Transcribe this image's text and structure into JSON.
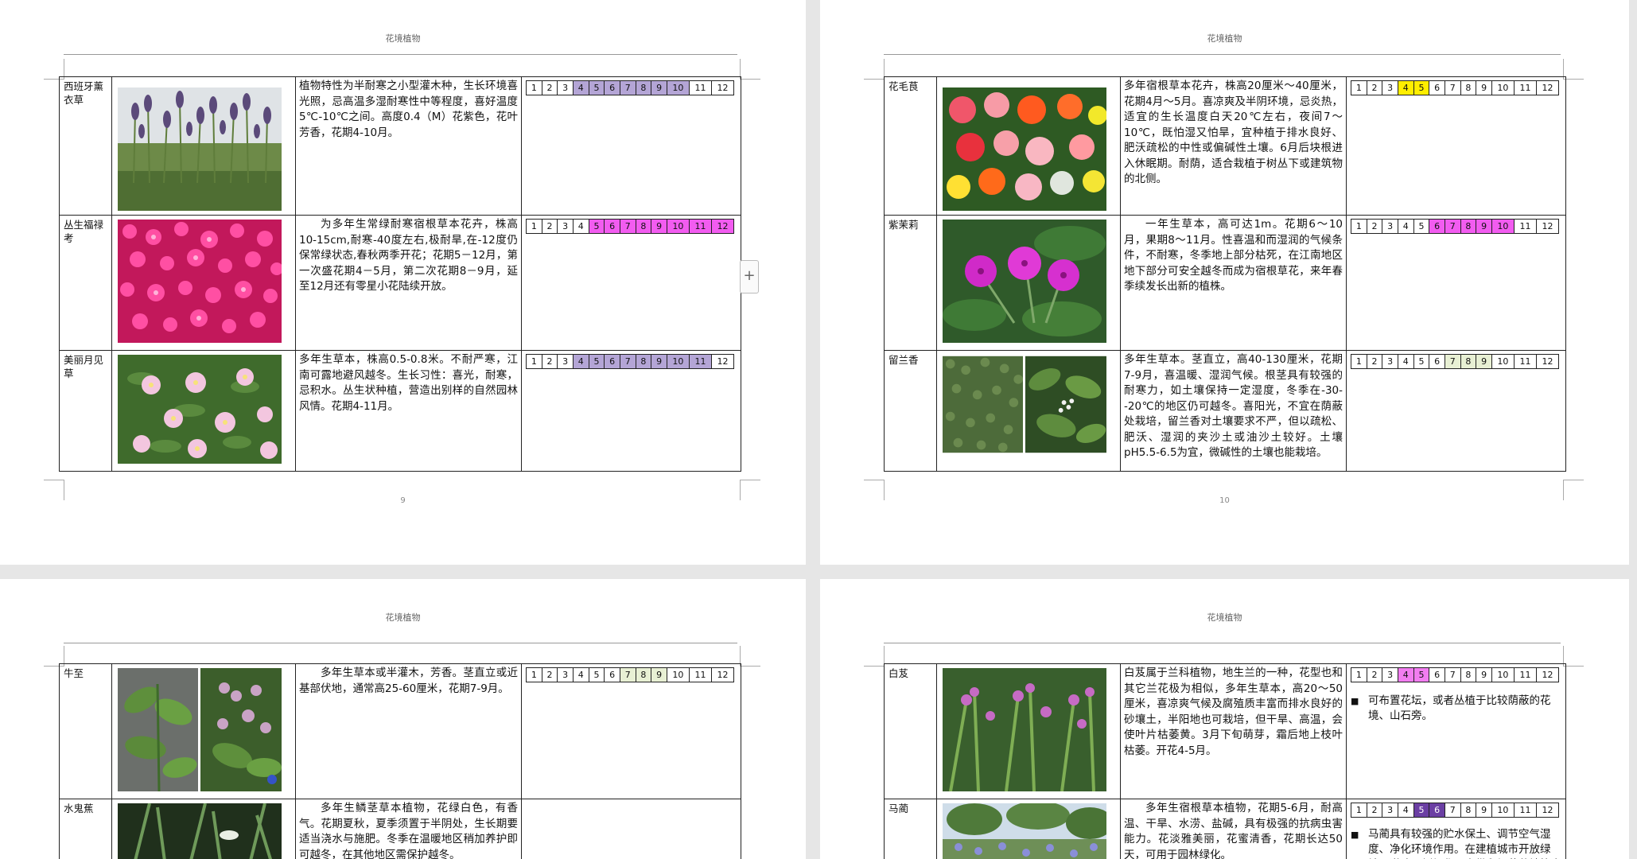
{
  "header_title": "花境植物",
  "page_numbers": {
    "p9": "9",
    "p10": "10"
  },
  "month_labels": [
    "1",
    "2",
    "3",
    "4",
    "5",
    "6",
    "7",
    "8",
    "9",
    "10",
    "11",
    "12"
  ],
  "colors": {
    "purple": "#b4a5d6",
    "magenta": "#f25cf0",
    "yellow": "#ffee00",
    "lightgreen": "#e8f0d4",
    "darkpurple": "#6b3fa3",
    "pink": "#f27df0"
  },
  "plants": {
    "lavender": {
      "name": "西班牙薰衣草",
      "desc": "植物特性为半耐寒之小型灌木种，生长环境喜光照，忌高温多湿耐寒性中等程度，喜好温度5℃-10℃之间。高度0.4（M）花紫色，花叶芳香，花期4-10月。",
      "bloom": "4-10",
      "color": "purple"
    },
    "phlox": {
      "name": "丛生福禄考",
      "desc": "为多年生常绿耐寒宿根草本花卉，株高10-15cm,耐寒-40度左右,极耐旱,在-12度仍保常绿状态,春秋两季开花；花期5－12月，第一次盛花期4－5月，第二次花期8－9月，延至12月还有零星小花陆续开放。",
      "bloom": "5-12",
      "color": "magenta"
    },
    "primrose": {
      "name": "美丽月见草",
      "desc": "多年生草本，株高0.5-0.8米。不耐严寒，江南可露地避风越冬。生长习性：喜光，耐寒，忌积水。丛生状种植，营造出别样的自然园林风情。花期4-11月。",
      "bloom": "4-11",
      "color": "purple"
    },
    "ranunculus": {
      "name": "花毛茛",
      "desc": "多年宿根草本花卉，株高20厘米～40厘米，花期4月～5月。喜凉爽及半阴环境，忌炎热，适宜的生长温度白天20℃左右，夜间7～10℃，既怕湿又怕旱，宜种植于排水良好、肥沃疏松的中性或偏碱性土壤。6月后块根进入休眠期。耐荫，适合栽植于树丛下或建筑物的北侧。",
      "bloom": "4-5",
      "color": "yellow"
    },
    "mirabilis": {
      "name": "紫茉莉",
      "desc": "一年生草本，高可达1m。花期6～10月，果期8～11月。性喜温和而湿润的气候条件，不耐寒，冬季地上部分枯死，在江南地区地下部分可安全越冬而成为宿根草花，来年春季续发长出新的植株。",
      "bloom": "6-10",
      "color": "magenta"
    },
    "spearmint": {
      "name": "留兰香",
      "desc": "多年生草本。茎直立，高40-130厘米，花期7-9月，喜温暖、湿润气候。根茎具有较强的耐寒力，如土壤保持一定湿度，冬季在-30--20℃的地区仍可越冬。喜阳光，不宜在荫蔽处栽培，留兰香对土壤要求不严，但以疏松、肥沃、湿润的夹沙土或油沙土较好。土壤pH5.5-6.5为宜，微碱性的土壤也能栽培。",
      "bloom": "7-9",
      "color": "lightgreen"
    },
    "agastache": {
      "name": "牛至",
      "desc": "多年生草本或半灌木，芳香。茎直立或近基部伏地，通常高25-60厘米，花期7-9月。",
      "bloom": "7-9",
      "color": "lightgreen"
    },
    "iris": {
      "name": "水鬼蕉",
      "desc": "多年生鳞茎草本植物，花绿白色，有香气。花期夏秋，夏季须置于半阴处，生长期要适当浇水与施肥。冬季在温暖地区稍加养护即可越冬，在其他地区需保护越冬。",
      "bloom": "",
      "color": ""
    },
    "bletilla": {
      "name": "白芨",
      "desc": "白芨属于兰科植物，地生兰的一种，花型也和其它兰花极为相似，多年生草本，高20～50厘米，喜凉爽气候及腐殖质丰富而排水良好的砂壤土，半阳地也可栽培，但干旱、高温，会使叶片枯萎黄。3月下旬萌芽，霜后地上枝叶枯萎。开花4-5月。",
      "bloom": "4-5",
      "color": "pink",
      "note": "可布置花坛，或者丛植于比较荫蔽的花境、山石旁。"
    },
    "maliani": {
      "name": "马蔺",
      "desc": "多年生宿根草本植物，花期5-6月，耐高温、干旱、水涝、盐碱，具有极强的抗病虫害能力。花淡雅美丽，花蜜清香，花期长达50天，可用于园林绿化。",
      "bloom": "5-6",
      "color": "darkpurple",
      "note": "马蔺具有较强的贮水保土、调节空气湿度、净化环境作用。在建植城市开放绿地、道路两侧绿化隔离带和缀花草地等方面有广泛应用。"
    }
  }
}
